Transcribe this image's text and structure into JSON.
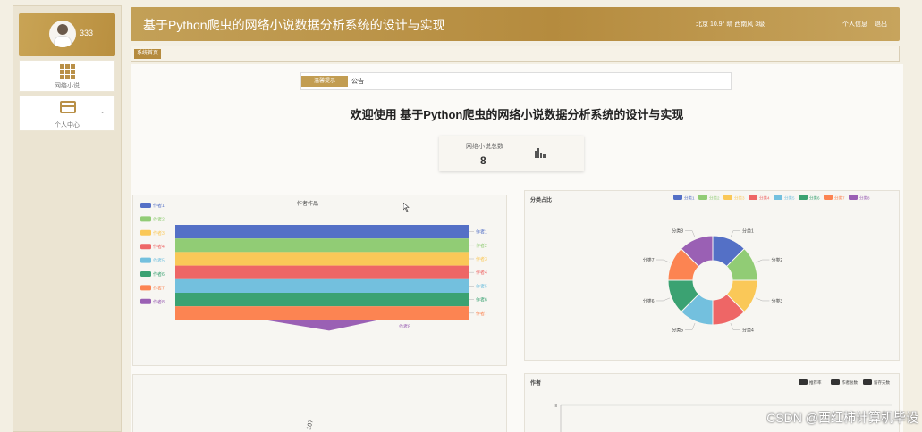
{
  "sidebar": {
    "username": "333",
    "menu": [
      {
        "label": "网络小说",
        "icon": "grid-icon"
      },
      {
        "label": "个人中心",
        "icon": "card-icon"
      }
    ]
  },
  "header": {
    "title": "基于Python爬虫的网络小说数据分析系统的设计与实现",
    "weather": "北京  10.9°  晴  西南风  3级",
    "links": [
      "个人信息",
      "退出"
    ]
  },
  "breadcrumb": "系统首页",
  "notice": {
    "label": "温馨提示",
    "text": "公告"
  },
  "welcome": "欢迎使用 基于Python爬虫的网络小说数据分析系统的设计与实现",
  "stat": {
    "label": "网络小说总数",
    "value": "8"
  },
  "colors": [
    "#5470c6",
    "#91cc75",
    "#fac858",
    "#ee6666",
    "#73c0de",
    "#3ba272",
    "#fc8452",
    "#9a60b4"
  ],
  "chart_data": [
    {
      "type": "funnel",
      "title": "作者作品",
      "categories": [
        "作者1",
        "作者2",
        "作者3",
        "作者4",
        "作者5",
        "作者6",
        "作者7",
        "作者8"
      ],
      "legend": "left"
    },
    {
      "type": "pie",
      "title": "分类占比",
      "categories": [
        "分类1",
        "分类2",
        "分类3",
        "分类4",
        "分类5",
        "分类6",
        "分类7",
        "分类8"
      ],
      "values": [
        1,
        1,
        1,
        1,
        1,
        1,
        1,
        1
      ],
      "legend": "top-right"
    },
    {
      "type": "bar",
      "title": "作者",
      "series": [
        {
          "name": "推荐率"
        },
        {
          "name": "作者总数"
        },
        {
          "name": "留存天数"
        }
      ],
      "ytick": "8",
      "legend": "top-right"
    },
    {
      "type": "bar",
      "title": "",
      "label": "107"
    }
  ],
  "watermark": "CSDN @西红柿计算机毕设"
}
